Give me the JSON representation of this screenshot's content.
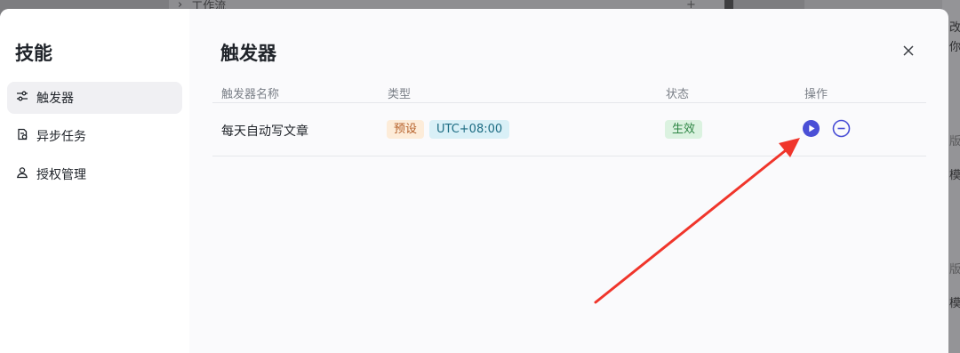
{
  "background": {
    "workflow_label": "工作流",
    "right_texts": [
      "改",
      "你",
      "版",
      "模",
      "版",
      "模"
    ]
  },
  "sidebar": {
    "title": "技能",
    "items": [
      {
        "label": "触发器",
        "icon": "sliders-icon",
        "active": true
      },
      {
        "label": "异步任务",
        "icon": "task-file-icon",
        "active": false
      },
      {
        "label": "授权管理",
        "icon": "user-auth-icon",
        "active": false
      }
    ]
  },
  "main": {
    "title": "触发器",
    "columns": [
      "触发器名称",
      "类型",
      "状态",
      "操作"
    ],
    "rows": [
      {
        "name": "每天自动写文章",
        "type_tags": [
          "预设",
          "UTC+08:00"
        ],
        "status": "生效"
      }
    ]
  },
  "colors": {
    "accent": "#4a4fd6",
    "annotation_arrow": "#f0352b"
  }
}
